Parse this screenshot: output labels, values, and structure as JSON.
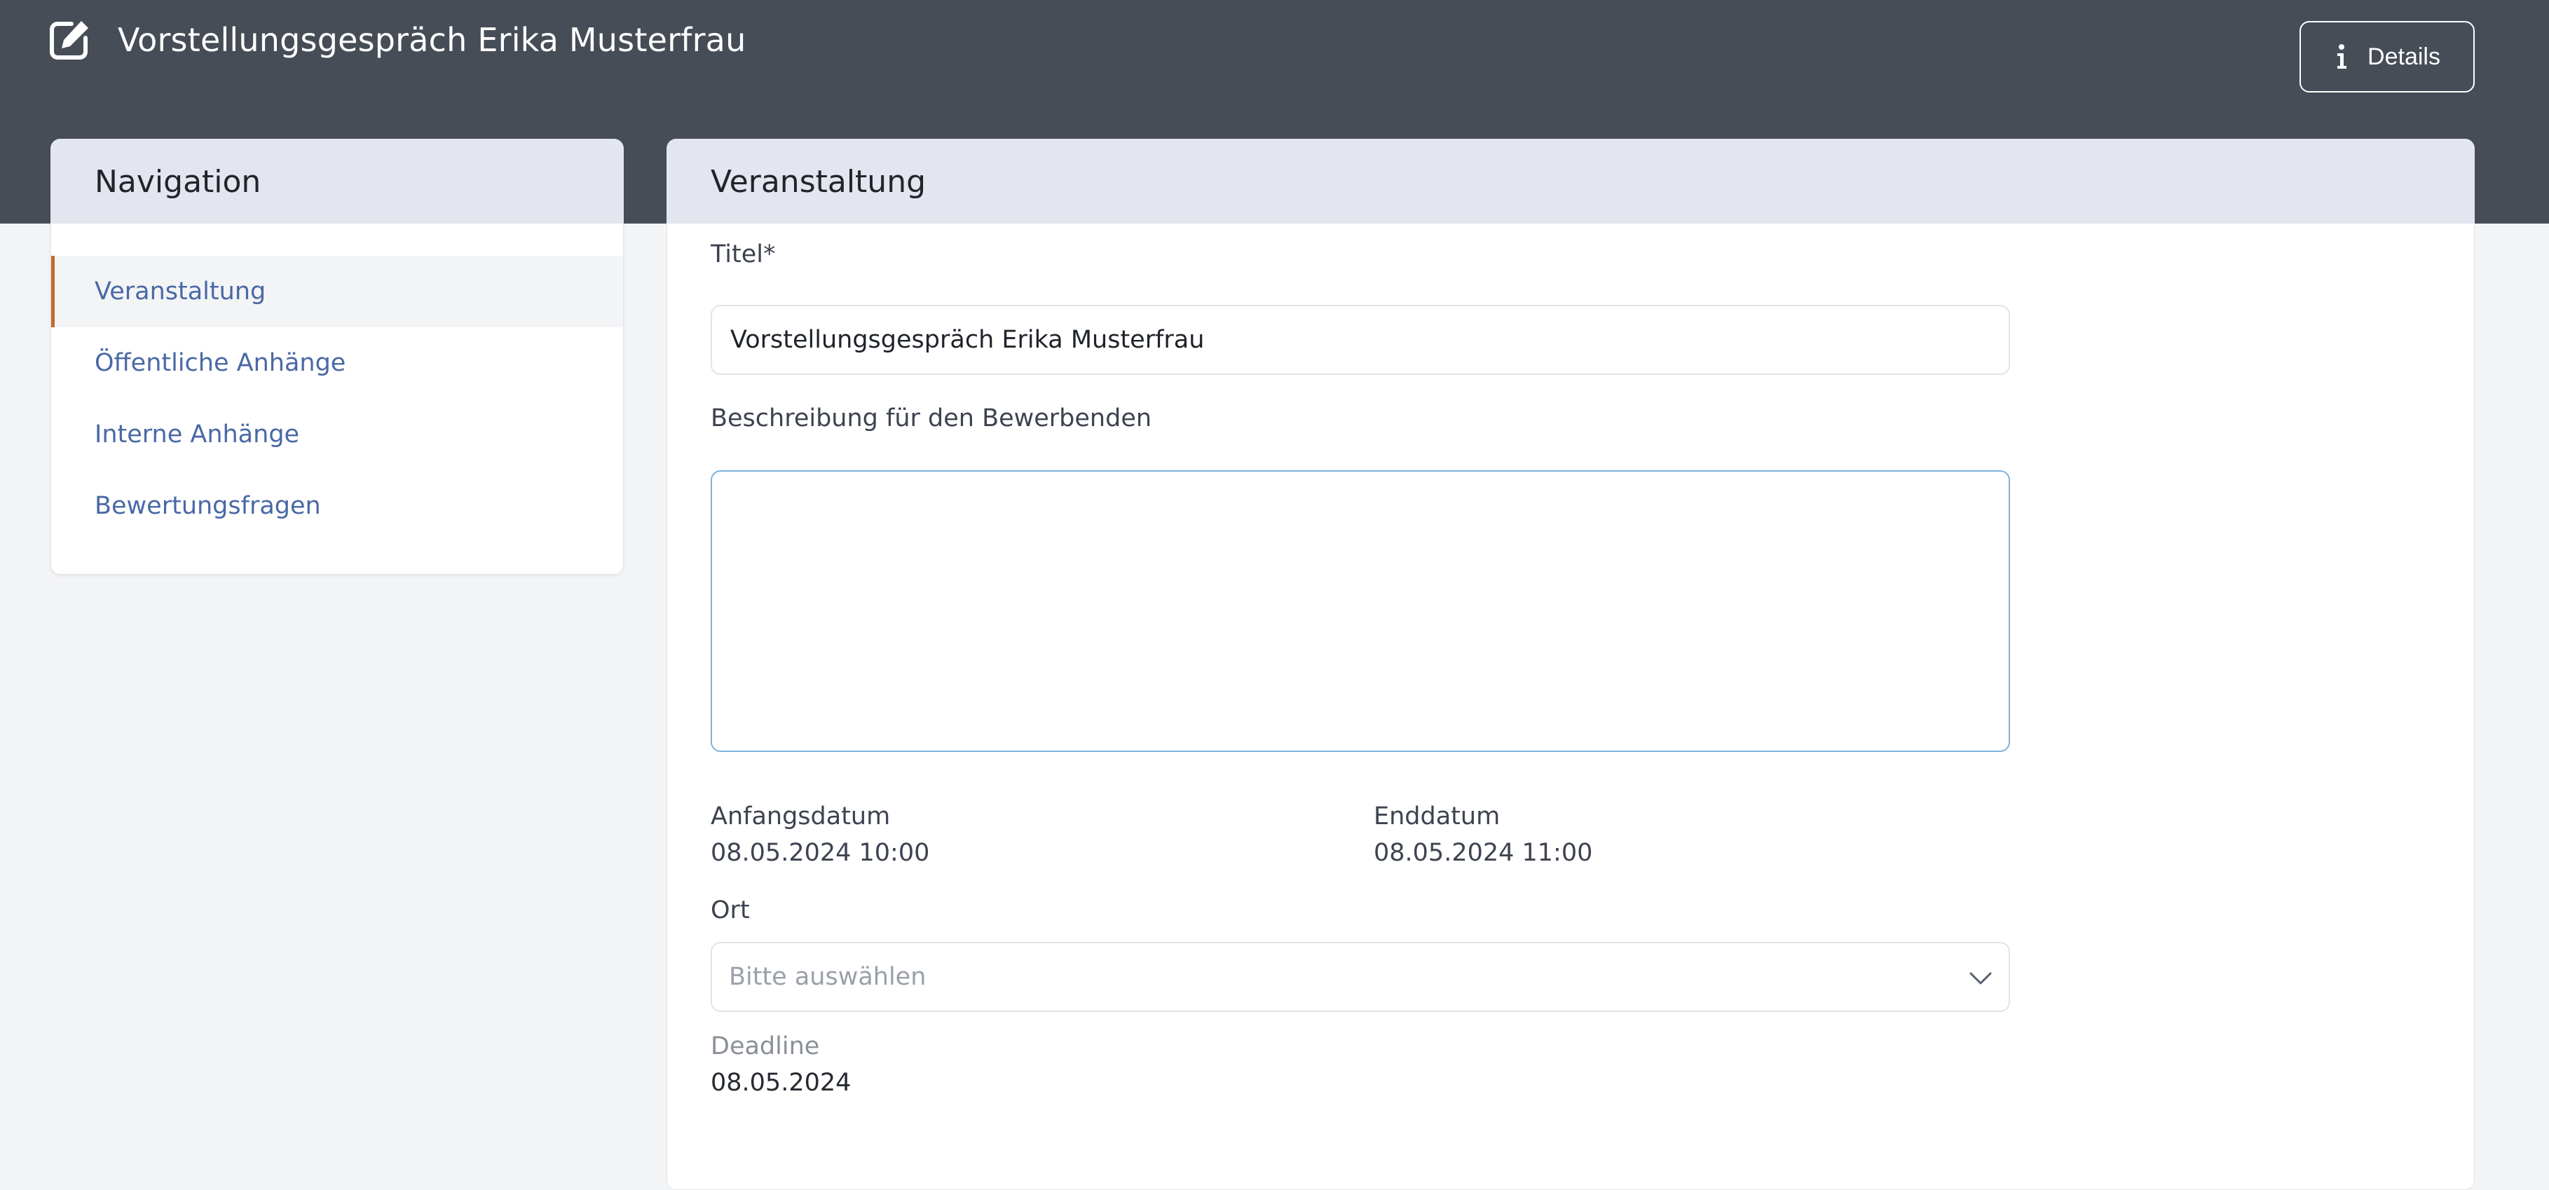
{
  "header": {
    "title": "Vorstellungsgespräch Erika Musterfrau",
    "details_label": "Details",
    "icons": {
      "edit": "edit-icon",
      "info": "info-icon"
    }
  },
  "navigation": {
    "title": "Navigation",
    "items": [
      {
        "label": "Veranstaltung",
        "active": true
      },
      {
        "label": "Öffentliche Anhänge",
        "active": false
      },
      {
        "label": "Interne Anhänge",
        "active": false
      },
      {
        "label": "Bewertungsfragen",
        "active": false
      }
    ]
  },
  "main": {
    "title": "Veranstaltung",
    "fields": {
      "title_label": "Titel*",
      "title_value": "Vorstellungsgespräch Erika Musterfrau",
      "description_label": "Beschreibung für den Bewerbenden",
      "description_value": "",
      "start_label": "Anfangsdatum",
      "start_value": "08.05.2024 10:00",
      "end_label": "Enddatum",
      "end_value": "08.05.2024 11:00",
      "location_label": "Ort",
      "location_placeholder": "Bitte auswählen",
      "deadline_label": "Deadline",
      "deadline_value": "08.05.2024"
    }
  },
  "colors": {
    "topbar": "#474d57",
    "card_header": "#e3e6ee",
    "nav_link": "#4a68a6",
    "active_marker": "#c46a2f",
    "focus_border": "#7fb1dc"
  }
}
